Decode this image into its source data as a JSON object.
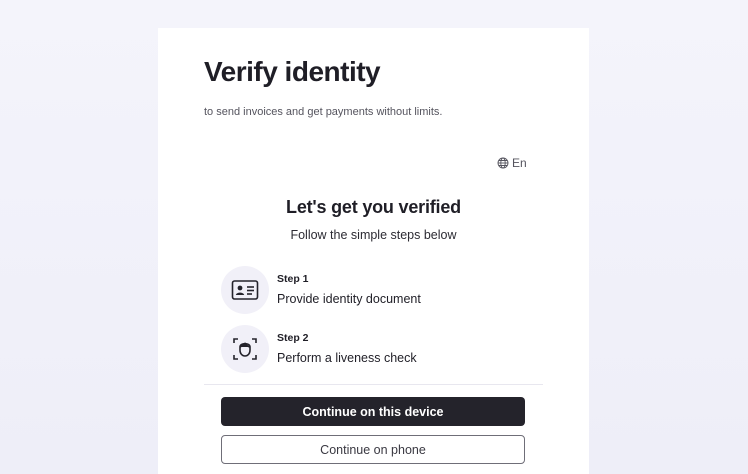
{
  "page": {
    "title": "Verify identity",
    "subtitle": "to send invoices and get payments without limits."
  },
  "language": {
    "label": "En",
    "icon": "globe-icon"
  },
  "verification": {
    "heading": "Let's get you verified",
    "lead": "Follow the simple steps below",
    "steps": [
      {
        "label": "Step 1",
        "text": "Provide identity document",
        "icon": "id-card-icon"
      },
      {
        "label": "Step 2",
        "text": "Perform a liveness check",
        "icon": "face-scan-icon"
      }
    ]
  },
  "actions": {
    "primary_label": "Continue on this device",
    "secondary_label": "Continue on phone"
  },
  "colors": {
    "background": "#eeeef8",
    "card": "#ffffff",
    "primary_button": "#24232b",
    "icon_badge": "#f1f0f8"
  }
}
